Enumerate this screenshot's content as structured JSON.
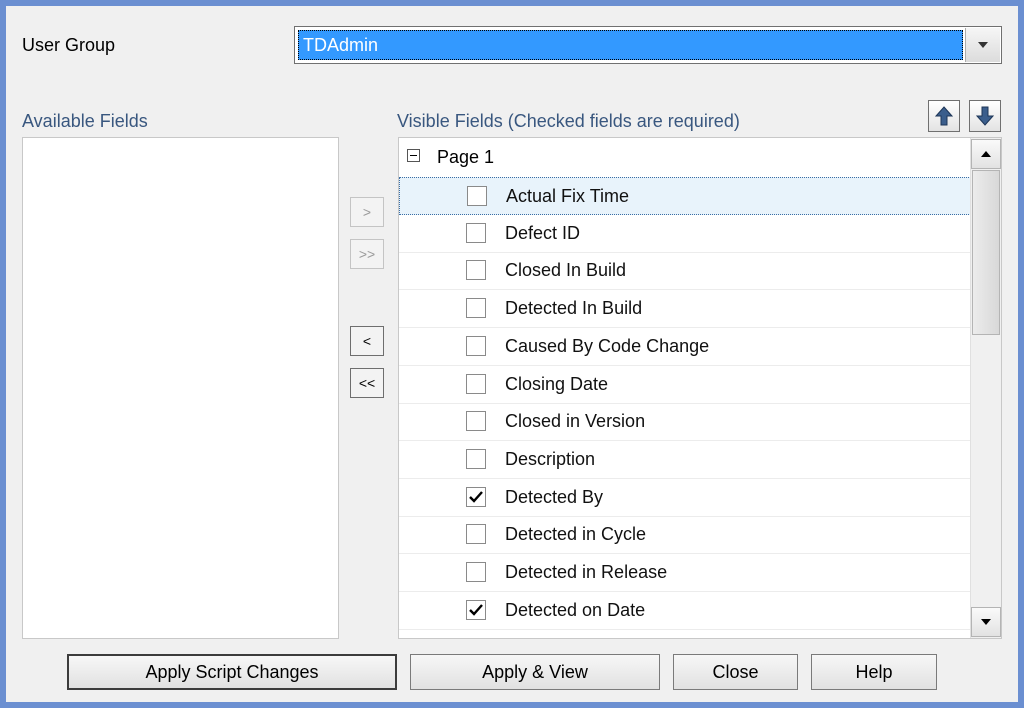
{
  "user_group": {
    "label": "User Group",
    "selected": "TDAdmin"
  },
  "available_fields": {
    "label": "Available Fields",
    "items": []
  },
  "move_buttons": {
    "add": ">",
    "add_all": ">>",
    "remove": "<",
    "remove_all": "<<"
  },
  "visible_fields": {
    "label": "Visible Fields (Checked fields are required)",
    "root": "Page 1",
    "rows": [
      {
        "label": "Actual Fix Time",
        "checked": false,
        "selected": true
      },
      {
        "label": "Defect ID",
        "checked": false,
        "selected": false
      },
      {
        "label": "Closed In Build",
        "checked": false,
        "selected": false
      },
      {
        "label": "Detected In Build",
        "checked": false,
        "selected": false
      },
      {
        "label": "Caused By Code Change",
        "checked": false,
        "selected": false
      },
      {
        "label": "Closing Date",
        "checked": false,
        "selected": false
      },
      {
        "label": "Closed in Version",
        "checked": false,
        "selected": false
      },
      {
        "label": "Description",
        "checked": false,
        "selected": false
      },
      {
        "label": "Detected By",
        "checked": true,
        "selected": false
      },
      {
        "label": "Detected in Cycle",
        "checked": false,
        "selected": false
      },
      {
        "label": "Detected in Release",
        "checked": false,
        "selected": false
      },
      {
        "label": "Detected on Date",
        "checked": true,
        "selected": false
      }
    ]
  },
  "footer": {
    "apply_script": "Apply Script Changes",
    "apply_view": "Apply & View",
    "close": "Close",
    "help": "Help"
  }
}
